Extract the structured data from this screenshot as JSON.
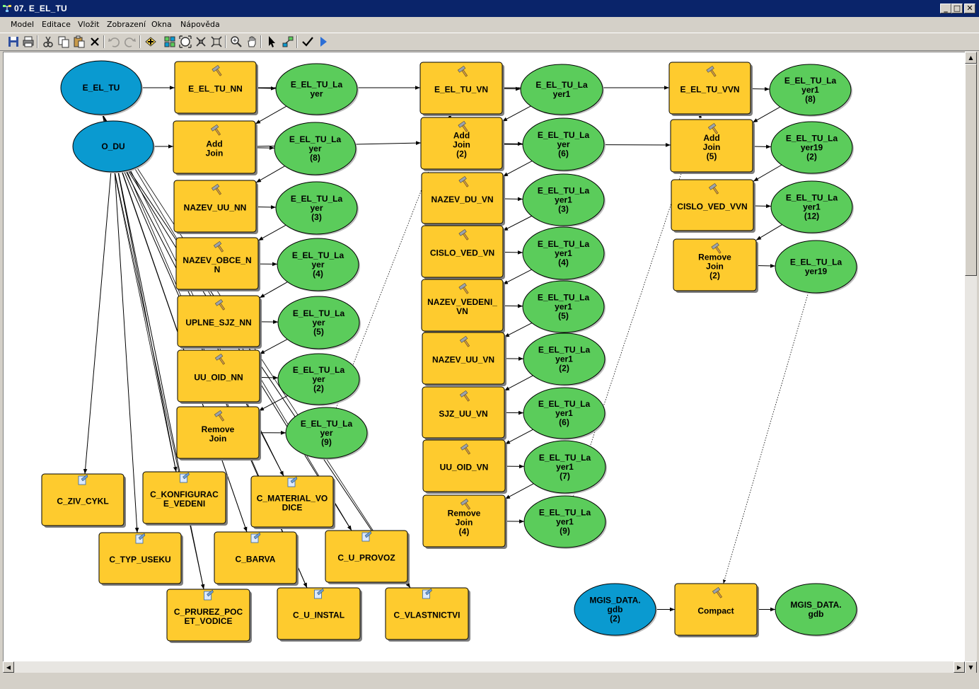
{
  "window": {
    "title": "07. E_EL_TU",
    "minimize": "_",
    "maximize": "□",
    "close": "✕"
  },
  "menu": [
    "Model",
    "Editace",
    "Vložit",
    "Zobrazení",
    "Okna",
    "Nápověda"
  ],
  "toolbar": [
    {
      "name": "save-icon"
    },
    {
      "name": "print-icon"
    },
    {
      "name": "cut-icon"
    },
    {
      "name": "copy-icon"
    },
    {
      "name": "paste-icon"
    },
    {
      "name": "delete-icon"
    },
    {
      "name": "undo-icon",
      "disabled": true
    },
    {
      "name": "redo-icon",
      "disabled": true
    },
    {
      "name": "add-data-icon"
    },
    {
      "name": "auto-layout-icon"
    },
    {
      "name": "full-extent-icon"
    },
    {
      "name": "fixed-zoom-in-icon"
    },
    {
      "name": "fixed-zoom-out-icon"
    },
    {
      "name": "zoom-in-icon"
    },
    {
      "name": "pan-icon"
    },
    {
      "name": "select-icon"
    },
    {
      "name": "connect-icon"
    },
    {
      "name": "validate-icon"
    },
    {
      "name": "run-icon"
    }
  ],
  "colors": {
    "tool": "#fecb2e",
    "derived": "#5bcc5b",
    "input": "#0a9ad0",
    "shadow": "#7f7f7f"
  },
  "model": {
    "nodes": [
      {
        "id": "in_eeltu",
        "type": "input",
        "label": "E_EL_TU"
      },
      {
        "id": "in_odu",
        "type": "input",
        "label": "O_DU"
      },
      {
        "id": "t1",
        "type": "tool",
        "label": "E_EL_TU_NN"
      },
      {
        "id": "d1",
        "type": "derived",
        "label": "E_EL_TU_La yer"
      },
      {
        "id": "t2",
        "type": "tool",
        "label": "Add Join"
      },
      {
        "id": "d2",
        "type": "derived",
        "label": "E_EL_TU_La yer (8)"
      },
      {
        "id": "t3",
        "type": "tool",
        "label": "NAZEV_UU_NN"
      },
      {
        "id": "d3",
        "type": "derived",
        "label": "E_EL_TU_La yer (3)"
      },
      {
        "id": "t4",
        "type": "tool",
        "label": "NAZEV_OBCE_N N"
      },
      {
        "id": "d4",
        "type": "derived",
        "label": "E_EL_TU_La yer (4)"
      },
      {
        "id": "t5",
        "type": "tool",
        "label": "UPLNE_SJZ_NN"
      },
      {
        "id": "d5",
        "type": "derived",
        "label": "E_EL_TU_La yer (5)"
      },
      {
        "id": "t6",
        "type": "tool",
        "label": "UU_OID_NN"
      },
      {
        "id": "d6",
        "type": "derived",
        "label": "E_EL_TU_La yer (2)"
      },
      {
        "id": "t7",
        "type": "tool",
        "label": "Remove Join"
      },
      {
        "id": "d7",
        "type": "derived",
        "label": "E_EL_TU_La yer (9)"
      },
      {
        "id": "m1",
        "type": "tool",
        "label": "E_EL_TU_VN"
      },
      {
        "id": "e1",
        "type": "derived",
        "label": "E_EL_TU_La yer1"
      },
      {
        "id": "m2",
        "type": "tool",
        "label": "Add Join (2)"
      },
      {
        "id": "e2",
        "type": "derived",
        "label": "E_EL_TU_La yer (6)"
      },
      {
        "id": "m3",
        "type": "tool",
        "label": "NAZEV_DU_VN"
      },
      {
        "id": "e3",
        "type": "derived",
        "label": "E_EL_TU_La yer1 (3)"
      },
      {
        "id": "m4",
        "type": "tool",
        "label": "CISLO_VED_VN"
      },
      {
        "id": "e4",
        "type": "derived",
        "label": "E_EL_TU_La yer1 (4)"
      },
      {
        "id": "m5",
        "type": "tool",
        "label": "NAZEV_VEDENI_ VN"
      },
      {
        "id": "e5",
        "type": "derived",
        "label": "E_EL_TU_La yer1 (5)"
      },
      {
        "id": "m6",
        "type": "tool",
        "label": "NAZEV_UU_VN"
      },
      {
        "id": "e6",
        "type": "derived",
        "label": "E_EL_TU_La yer1 (2)"
      },
      {
        "id": "m7",
        "type": "tool",
        "label": "SJZ_UU_VN"
      },
      {
        "id": "e7",
        "type": "derived",
        "label": "E_EL_TU_La yer1 (6)"
      },
      {
        "id": "m8",
        "type": "tool",
        "label": "UU_OID_VN"
      },
      {
        "id": "e8",
        "type": "derived",
        "label": "E_EL_TU_La yer1 (7)"
      },
      {
        "id": "m9",
        "type": "tool",
        "label": "Remove Join (4)"
      },
      {
        "id": "e9",
        "type": "derived",
        "label": "E_EL_TU_La yer1 (9)"
      },
      {
        "id": "r1",
        "type": "tool",
        "label": "E_EL_TU_VVN"
      },
      {
        "id": "f1",
        "type": "derived",
        "label": "E_EL_TU_La yer1 (8)"
      },
      {
        "id": "r2",
        "type": "tool",
        "label": "Add Join (5)"
      },
      {
        "id": "f2",
        "type": "derived",
        "label": "E_EL_TU_La yer19 (2)"
      },
      {
        "id": "r3",
        "type": "tool",
        "label": "CISLO_VED_VVN"
      },
      {
        "id": "f3",
        "type": "derived",
        "label": "E_EL_TU_La yer1 (12)"
      },
      {
        "id": "r4",
        "type": "tool",
        "label": "Remove Join (2)"
      },
      {
        "id": "f4",
        "type": "derived",
        "label": "E_EL_TU_La yer19"
      },
      {
        "id": "in_mgis",
        "type": "input",
        "label": "MGIS_DATA. gdb (2)"
      },
      {
        "id": "compact",
        "type": "tool",
        "label": "Compact"
      },
      {
        "id": "out_mgis",
        "type": "derived",
        "label": "MGIS_DATA. gdb"
      },
      {
        "id": "c1",
        "type": "tool",
        "label": "C_ZIV_CYKL",
        "icon": "script"
      },
      {
        "id": "c2",
        "type": "tool",
        "label": "C_KONFIGURAC E_VEDENI",
        "icon": "script"
      },
      {
        "id": "c3",
        "type": "tool",
        "label": "C_MATERIAL_VO DICE",
        "icon": "script"
      },
      {
        "id": "c4",
        "type": "tool",
        "label": "C_TYP_USEKU",
        "icon": "script"
      },
      {
        "id": "c5",
        "type": "tool",
        "label": "C_BARVA",
        "icon": "script"
      },
      {
        "id": "c6",
        "type": "tool",
        "label": "C_U_PROVOZ",
        "icon": "script"
      },
      {
        "id": "c7",
        "type": "tool",
        "label": "C_PRUREZ_POC ET_VODICE",
        "icon": "script"
      },
      {
        "id": "c8",
        "type": "tool",
        "label": "C_U_INSTAL",
        "icon": "script"
      },
      {
        "id": "c9",
        "type": "tool",
        "label": "C_VLASTNICTVI",
        "icon": "script"
      }
    ]
  }
}
